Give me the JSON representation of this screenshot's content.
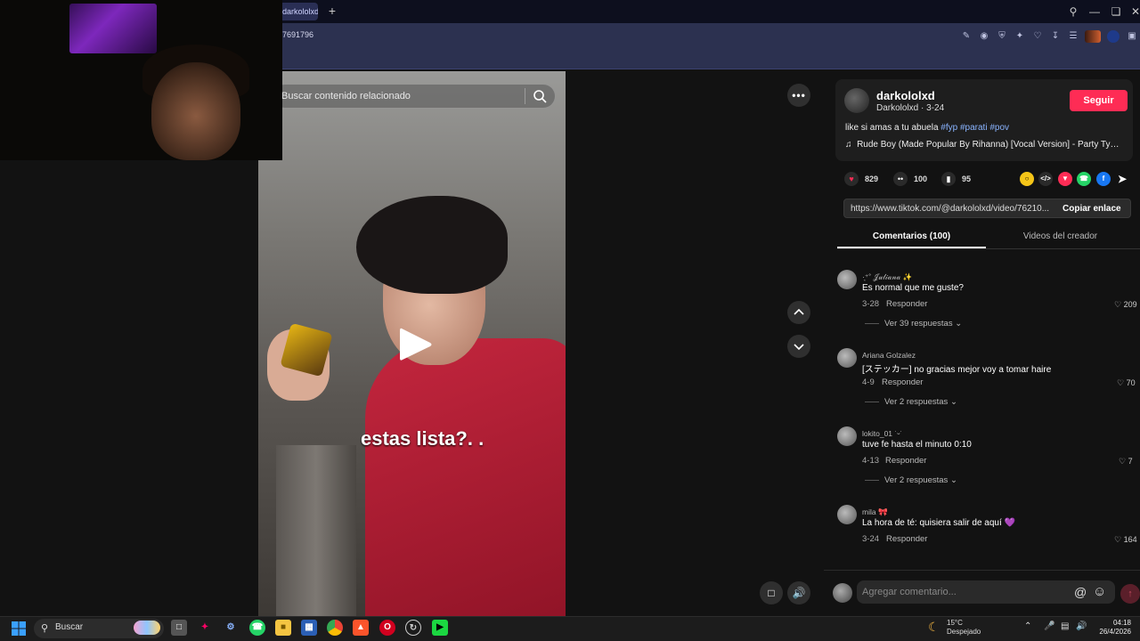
{
  "browser": {
    "tab_title": "darkololxd",
    "new_tab": "+",
    "url_fragment": "7691796",
    "window_controls": [
      "search-icon",
      "minimize-icon",
      "restore-icon",
      "close-icon"
    ]
  },
  "video": {
    "search_placeholder": "Buscar contenido relacionado",
    "caption": "estas lista?. .",
    "more_label": "•••",
    "nav_up": "⌃",
    "nav_down": "⌄"
  },
  "post": {
    "username": "darkololxd",
    "handle_date": "Darkololxd · 3-24",
    "follow_label": "Seguir",
    "description_text": "like si amas a tu abuela ",
    "hashtags": "#fyp #parati #pov",
    "music": "Rude Boy (Made Popular By Rihanna) [Vocal Version] - Party Tyme...",
    "likes": "829",
    "comments": "100",
    "saves": "95",
    "link": "https://www.tiktok.com/@darkololxd/video/76210...",
    "copy_label": "Copiar enlace"
  },
  "tabs": {
    "comments": "Comentarios (100)",
    "creator": "Videos del creador"
  },
  "comments": [
    {
      "user": "·͙⁺˚ 𝒥𝓊𝓁𝒾𝒶𝓃𝒶 ✨",
      "text": "Es normal que me guste?",
      "date": "3-28",
      "reply": "Responder",
      "likes": "209",
      "more": "Ver 39 respuestas"
    },
    {
      "user": "Ariana Golzalez",
      "text": "[ステッカー] no gracias mejor voy a tomar haire",
      "date": "4-9",
      "reply": "Responder",
      "likes": "70",
      "more": "Ver 2 respuestas"
    },
    {
      "user": "lokito_01 ˙ᵕ˙",
      "text": "tuve fe hasta el minuto 0:10",
      "date": "4-13",
      "reply": "Responder",
      "likes": "7",
      "more": "Ver 2 respuestas"
    },
    {
      "user": "mila 🎀",
      "text": "La hora de té: quisiera salir de aquí 💜",
      "date": "3-24",
      "reply": "Responder",
      "likes": "164"
    }
  ],
  "comment_input": {
    "placeholder": "Agregar comentario..."
  },
  "taskbar": {
    "search_label": "Buscar",
    "weather_temp": "15°C",
    "weather_desc": "Despejado",
    "time": "04:18",
    "date": "26/4/2026"
  },
  "colors": {
    "follow": "#fe2c55",
    "hashtag": "#8ab4ff",
    "background": "#121212"
  }
}
